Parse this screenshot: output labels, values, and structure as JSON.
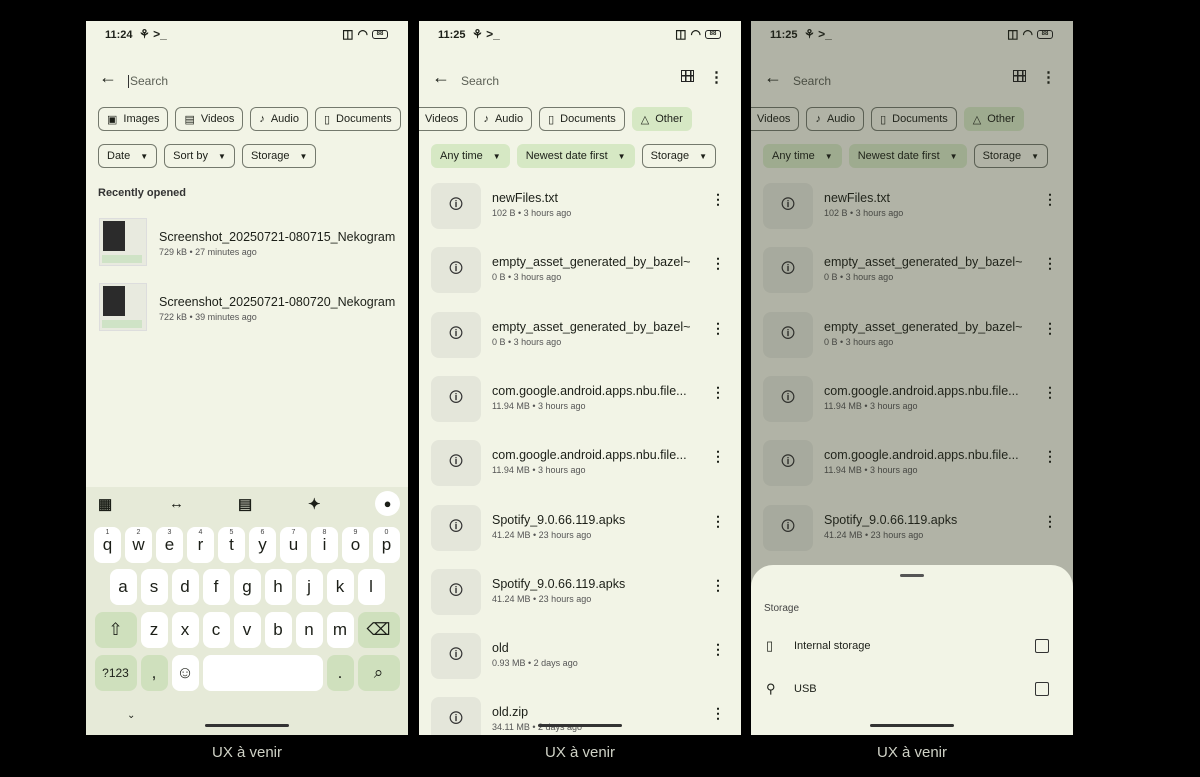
{
  "caption": "UX à venir",
  "status": {
    "time1": "11:24",
    "time2": "11:25",
    "time3": "11:25",
    "left_icons": "⚘ >_",
    "battery": "88"
  },
  "search": {
    "placeholder": "Search"
  },
  "phone1": {
    "chips": [
      "Images",
      "Videos",
      "Audio",
      "Documents"
    ],
    "filters": [
      "Date",
      "Sort by",
      "Storage"
    ],
    "section": "Recently opened",
    "recent": [
      {
        "name": "Screenshot_20250721-080715_Nekogram",
        "meta": "729 kB • 27 minutes ago"
      },
      {
        "name": "Screenshot_20250721-080720_Nekogram",
        "meta": "722 kB • 39 minutes ago"
      }
    ],
    "keyboard": {
      "numbers": [
        "1",
        "2",
        "3",
        "4",
        "5",
        "6",
        "7",
        "8",
        "9",
        "0"
      ],
      "row1": [
        "q",
        "w",
        "e",
        "r",
        "t",
        "y",
        "u",
        "i",
        "o",
        "p"
      ],
      "row2": [
        "a",
        "s",
        "d",
        "f",
        "g",
        "h",
        "j",
        "k",
        "l"
      ],
      "row3": [
        "z",
        "x",
        "c",
        "v",
        "b",
        "n",
        "m"
      ],
      "symbols": "?123",
      "comma": ",",
      "period": "."
    }
  },
  "phone2": {
    "chips": [
      "Videos",
      "Audio",
      "Documents",
      "Other"
    ],
    "filters": [
      "Any time",
      "Newest date first",
      "Storage"
    ],
    "files": [
      {
        "name": "newFiles.txt",
        "meta": "102 B • 3 hours ago"
      },
      {
        "name": "empty_asset_generated_by_bazel~",
        "meta": "0 B • 3 hours ago"
      },
      {
        "name": "empty_asset_generated_by_bazel~",
        "meta": "0 B • 3 hours ago"
      },
      {
        "name": "com.google.android.apps.nbu.file...",
        "meta": "11.94 MB • 3 hours ago"
      },
      {
        "name": "com.google.android.apps.nbu.file...",
        "meta": "11.94 MB • 3 hours ago"
      },
      {
        "name": "Spotify_9.0.66.119.apks",
        "meta": "41.24 MB • 23 hours ago"
      },
      {
        "name": "Spotify_9.0.66.119.apks",
        "meta": "41.24 MB • 23 hours ago"
      },
      {
        "name": "old",
        "meta": "0.93 MB • 2 days ago"
      },
      {
        "name": "old.zip",
        "meta": "34.11 MB • 2 days ago"
      }
    ]
  },
  "phone3": {
    "sheet": {
      "title": "Storage",
      "options": [
        {
          "label": "Internal storage",
          "checked": false
        },
        {
          "label": "USB",
          "checked": false
        }
      ]
    }
  },
  "colors": {
    "background": "#f2f4e6",
    "selected_chip": "#d6e8c4",
    "keyboard": "#e6ead8",
    "accent_key": "#cfe0bd"
  },
  "icons": [
    "back-arrow-icon",
    "grid-view-icon",
    "more-vert-icon",
    "image-icon",
    "video-icon",
    "audio-note-icon",
    "document-icon",
    "other-shapes-icon",
    "file-info-icon",
    "mic-icon",
    "phone-icon",
    "usb-icon"
  ]
}
